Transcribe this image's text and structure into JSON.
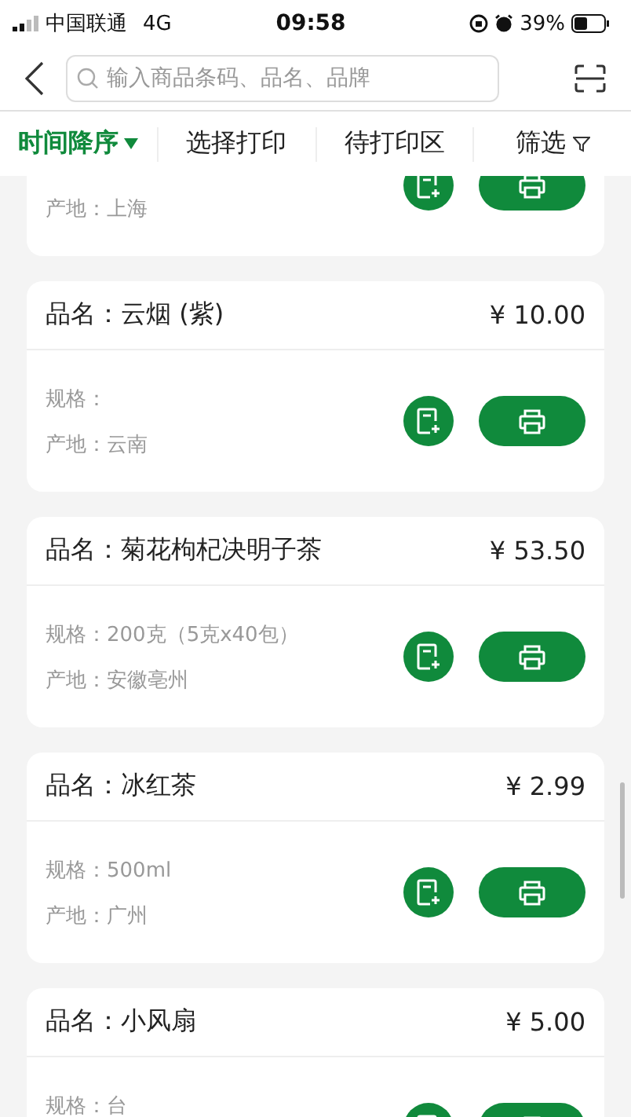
{
  "status_bar": {
    "carrier": "中国联通",
    "network": "4G",
    "time": "09:58",
    "battery": "39%"
  },
  "search": {
    "placeholder": "输入商品条码、品名、品牌"
  },
  "tabs": [
    {
      "label": "时间降序",
      "selected": true,
      "kind": "sort"
    },
    {
      "label": "选择打印",
      "selected": false,
      "kind": "plain"
    },
    {
      "label": "待打印区",
      "selected": false,
      "kind": "plain"
    },
    {
      "label": "筛选",
      "selected": false,
      "kind": "filter"
    }
  ],
  "products": [
    {
      "origin": "产地：上海"
    },
    {
      "name": "品名：云烟 (紫)",
      "price": "¥ 10.00",
      "spec": "规格：",
      "origin": "产地：云南"
    },
    {
      "name": "品名：菊花枸杞决明子茶",
      "price": "¥ 53.50",
      "spec": "规格：200克（5克x40包）",
      "origin": "产地：安徽亳州"
    },
    {
      "name": "品名：冰红茶",
      "price": "¥ 2.99",
      "spec": "规格：500ml",
      "origin": "产地：广州"
    },
    {
      "name": "品名：小风扇",
      "price": "¥ 5.00",
      "spec": "规格：台"
    }
  ]
}
